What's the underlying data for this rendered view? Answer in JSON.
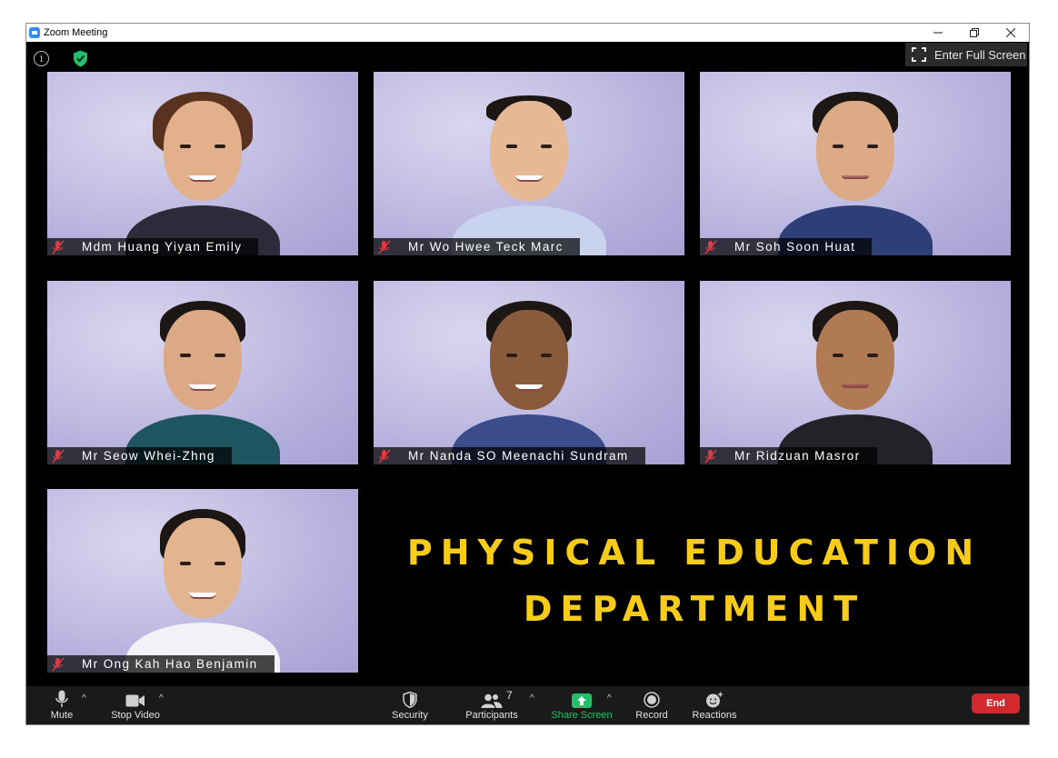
{
  "window": {
    "title": "Zoom Meeting",
    "controls": [
      "minimize-icon",
      "restore-icon",
      "close-icon"
    ]
  },
  "top_bar": {
    "fullscreen_label": "Enter Full Screen"
  },
  "participants": [
    {
      "name": "Mdm Huang Yiyan Emily",
      "muted": true
    },
    {
      "name": "Mr Wo Hwee Teck Marc",
      "muted": true
    },
    {
      "name": "Mr Soh Soon Huat",
      "muted": true
    },
    {
      "name": "Mr Seow Whei-Zhng",
      "muted": true
    },
    {
      "name": "Mr Nanda SO Meenachi Sundram",
      "muted": true
    },
    {
      "name": "Mr Ridzuan Masror",
      "muted": true
    },
    {
      "name": "Mr Ong Kah Hao Benjamin",
      "muted": true
    }
  ],
  "banner": {
    "line1": "PHYSICAL EDUCATION",
    "line2": "DEPARTMENT",
    "color": "#f7cb1a"
  },
  "toolbar": {
    "mute": "Mute",
    "stop_video": "Stop Video",
    "security": "Security",
    "participants": "Participants",
    "participants_count": "7",
    "share_screen": "Share Screen",
    "record": "Record",
    "reactions": "Reactions",
    "end": "End"
  },
  "colors": {
    "share_green": "#21c06b",
    "end_red": "#d3282d",
    "security_green": "#21c06b"
  }
}
